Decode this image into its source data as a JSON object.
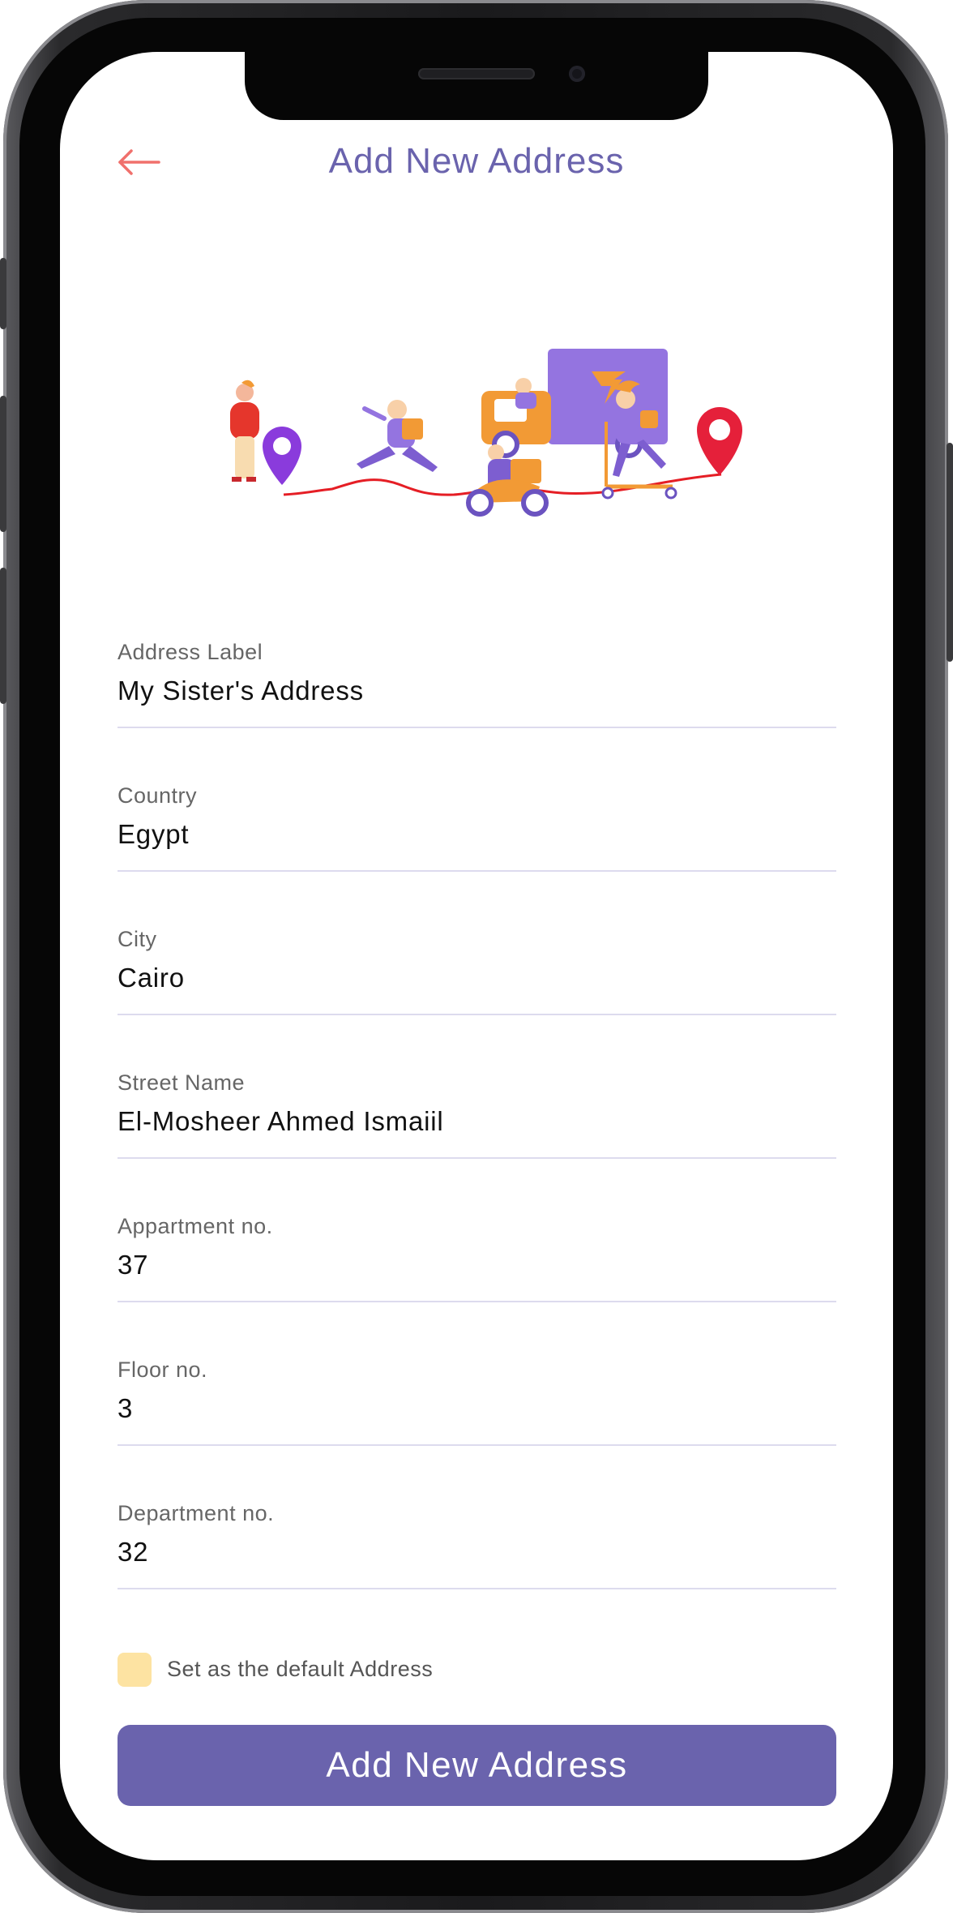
{
  "header": {
    "title": "Add New Address",
    "back_icon": "arrow-left-icon"
  },
  "illustration": {
    "icon": "delivery-route-illustration"
  },
  "form": {
    "fields": [
      {
        "label": "Address Label",
        "value": "My Sister's Address"
      },
      {
        "label": "Country",
        "value": "Egypt"
      },
      {
        "label": "City",
        "value": "Cairo"
      },
      {
        "label": "Street Name",
        "value": "El-Mosheer Ahmed Ismaiil"
      },
      {
        "label": "Appartment no.",
        "value": "37"
      },
      {
        "label": "Floor no.",
        "value": "3"
      },
      {
        "label": "Department no.",
        "value": "32"
      }
    ],
    "default_checkbox": {
      "label": "Set as the default Address",
      "checked": false
    },
    "submit_label": "Add New Address"
  },
  "colors": {
    "accent": "#6a63ad",
    "back_arrow": "#f0706c",
    "checkbox": "#fde3a2",
    "divider": "#dddbee"
  }
}
